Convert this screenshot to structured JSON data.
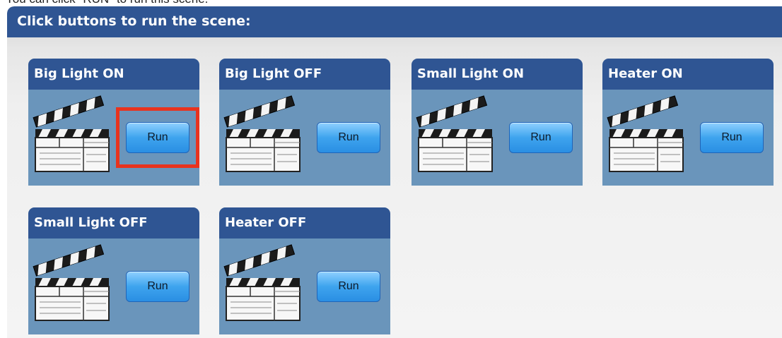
{
  "instruction": "You can click \"RUN\" to run this scene.",
  "header": {
    "title": "Click buttons to run the scene:"
  },
  "scenes": [
    {
      "title": "Big Light ON",
      "run_label": "Run",
      "highlighted": true
    },
    {
      "title": "Big Light OFF",
      "run_label": "Run",
      "highlighted": false
    },
    {
      "title": "Small Light ON",
      "run_label": "Run",
      "highlighted": false
    },
    {
      "title": "Heater ON",
      "run_label": "Run",
      "highlighted": false
    },
    {
      "title": "Small Light OFF",
      "run_label": "Run",
      "highlighted": false
    },
    {
      "title": "Heater OFF",
      "run_label": "Run",
      "highlighted": false
    }
  ],
  "colors": {
    "header_blue": "#2f5593",
    "card_body": "#6a95bb",
    "button_blue": "#3ea4ee",
    "highlight_red": "#e8331e"
  },
  "icons": {
    "scene_icon": "clapperboard-icon"
  }
}
